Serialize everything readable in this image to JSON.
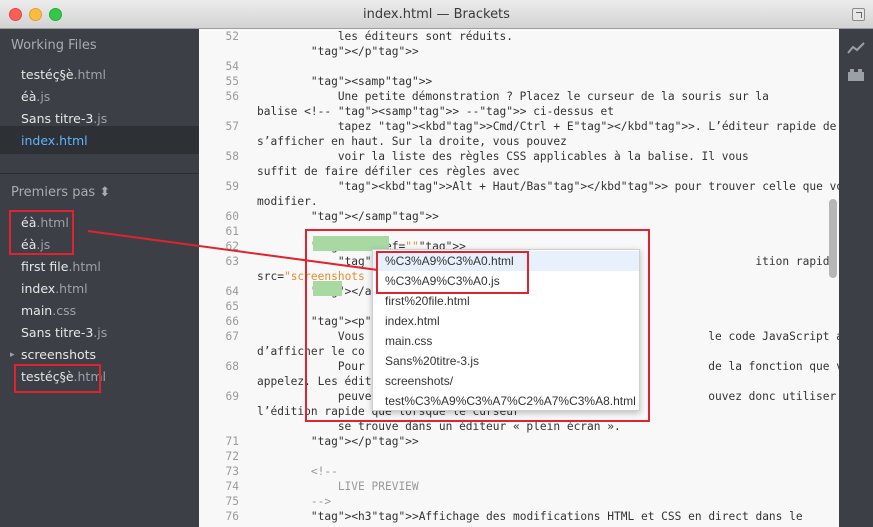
{
  "window": {
    "title": "index.html — Brackets"
  },
  "sidebar": {
    "working_files_title": "Working Files",
    "working_files": [
      {
        "name": "testéç§è",
        "ext": ".html"
      },
      {
        "name": "éà",
        "ext": ".js"
      },
      {
        "name": "Sans titre-3",
        "ext": ".js"
      },
      {
        "name": "index",
        "ext": ".html"
      }
    ],
    "project_title": "Premiers pas ⬍",
    "project_files": [
      {
        "name": "éà",
        "ext": ".html"
      },
      {
        "name": "éà",
        "ext": ".js"
      },
      {
        "name": "first file",
        "ext": ".html"
      },
      {
        "name": "index",
        "ext": ".html"
      },
      {
        "name": "main",
        "ext": ".css"
      },
      {
        "name": "Sans titre-3",
        "ext": ".js"
      },
      {
        "name": "screenshots",
        "ext": ""
      },
      {
        "name": "testéç§è",
        "ext": ".html"
      }
    ],
    "folder_arrow": "▸"
  },
  "editor": {
    "lines": [
      {
        "n": "52",
        "t": "            les éditeurs sont réduits."
      },
      {
        "n": "",
        "t": "        </p>"
      },
      {
        "n": "54",
        "t": ""
      },
      {
        "n": "55",
        "t": "        <samp>"
      },
      {
        "n": "56",
        "t": "            Une petite démonstration ? Placez le curseur de la souris sur la"
      },
      {
        "n": "",
        "t": "balise <!-- <samp> --> ci-dessus et"
      },
      {
        "n": "57",
        "t": "            tapez <kbd>Cmd/Ctrl + E</kbd>. L’éditeur rapide de CSS doit"
      },
      {
        "n": "",
        "t": "s’afficher en haut. Sur la droite, vous pouvez"
      },
      {
        "n": "58",
        "t": "            voir la liste des règles CSS applicables à la balise. Il vous"
      },
      {
        "n": "",
        "t": "suffit de faire défiler ces règles avec"
      },
      {
        "n": "59",
        "t": "            <kbd>Alt + Haut/Bas</kbd> pour trouver celle que vous souhaitez"
      },
      {
        "n": "",
        "t": "modifier."
      },
      {
        "n": "60",
        "t": "        </samp>"
      },
      {
        "n": "61",
        "t": ""
      },
      {
        "n": "62",
        "t": "        <a href=\"\">"
      },
      {
        "n": "63",
        "t": "            <img                                                    ition rapide CSS\""
      },
      {
        "n": "",
        "t": "src=\"screenshots"
      },
      {
        "n": "64",
        "t": "        </a>"
      },
      {
        "n": "65",
        "t": ""
      },
      {
        "n": "66",
        "t": "        <p>"
      },
      {
        "n": "67",
        "t": "            Vous                                                   le code JavaScript afin"
      },
      {
        "n": "",
        "t": "d’afficher le co"
      },
      {
        "n": "68",
        "t": "            Pour                                                   de la fonction que vous"
      },
      {
        "n": "",
        "t": "appelez. Les édit"
      },
      {
        "n": "69",
        "t": "            peuve                                                  ouvez donc utiliser"
      },
      {
        "n": "",
        "t": "l’édition rapide que lorsque le curseur"
      },
      {
        "n": "",
        "t": "            se trouve dans un éditeur « plein écran »."
      },
      {
        "n": "71",
        "t": "        </p>"
      },
      {
        "n": "72",
        "t": ""
      },
      {
        "n": "73",
        "t": "        <!--"
      },
      {
        "n": "74",
        "t": "            LIVE PREVIEW"
      },
      {
        "n": "75",
        "t": "        -->"
      },
      {
        "n": "76",
        "t": "        <h3>Affichage des modifications HTML et CSS en direct dans le"
      }
    ]
  },
  "code_hint": {
    "items": [
      "%C3%A9%C3%A0.html",
      "%C3%A9%C3%A0.js",
      "first%20file.html",
      "index.html",
      "main.css",
      "Sans%20titre-3.js",
      "screenshots/",
      "test%C3%A9%C3%A7%C2%A7%C3%A8.html"
    ]
  },
  "colors": {
    "annotation_red": "#e0232e",
    "selected_file": "#5fb3ff",
    "tag_blue": "#5b8fc7",
    "string_orange": "#e18c2e",
    "match_green": "#a9d9a3"
  }
}
